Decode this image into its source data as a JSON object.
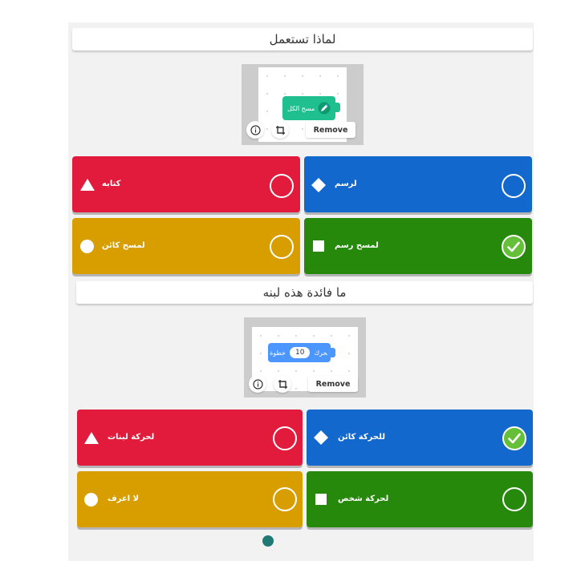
{
  "questions": [
    {
      "title": "لماذا تستعمل",
      "block_label": "مسح الكل",
      "remove_label": "Remove",
      "answers": [
        {
          "text": "كتابه",
          "shape": "triangle",
          "color": "#e21b3c",
          "correct": false
        },
        {
          "text": "لرسم",
          "shape": "diamond",
          "color": "#1368ce",
          "correct": false
        },
        {
          "text": "لمسح كائن",
          "shape": "circle",
          "color": "#d89e00",
          "correct": false
        },
        {
          "text": "لمسح رسم",
          "shape": "square",
          "color": "#26890c",
          "correct": true
        }
      ]
    },
    {
      "title": "ما فائدة هذه لبنه",
      "block_label_right": "تحرك",
      "block_number": "10",
      "block_label_left": "خطوة",
      "remove_label": "Remove",
      "answers": [
        {
          "text": "لحركة لبنات",
          "shape": "triangle",
          "color": "#e21b3c",
          "correct": false
        },
        {
          "text": "للحركة كائن",
          "shape": "diamond",
          "color": "#1368ce",
          "correct": true
        },
        {
          "text": "لا اعرف",
          "shape": "circle",
          "color": "#d89e00",
          "correct": false
        },
        {
          "text": "لحركة شخص",
          "shape": "square",
          "color": "#26890c",
          "correct": false
        }
      ]
    }
  ]
}
